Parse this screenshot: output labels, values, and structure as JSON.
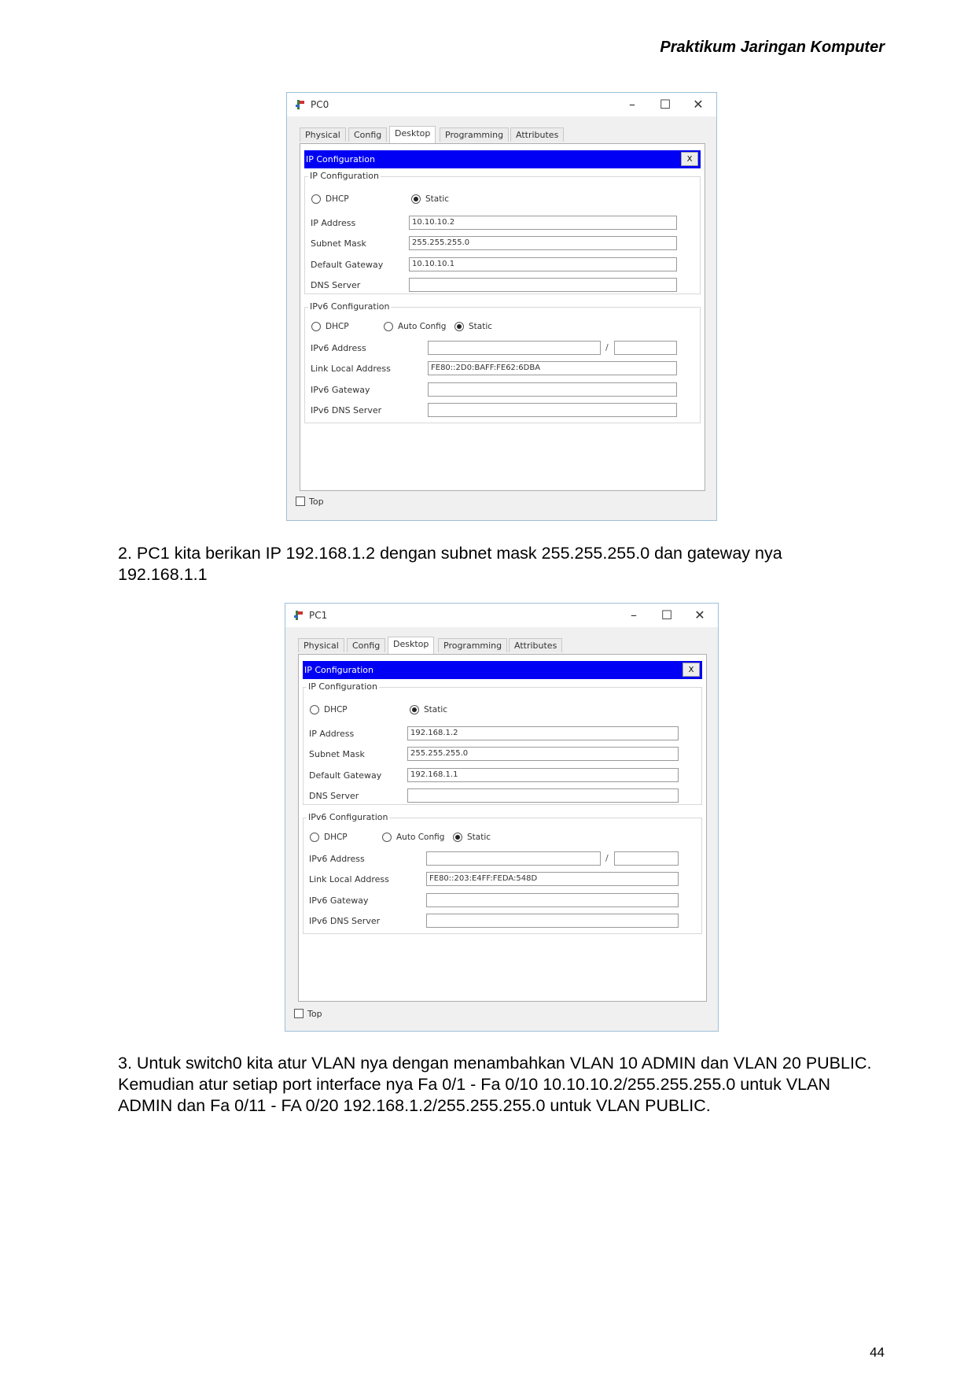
{
  "header": "Praktikum Jaringan Komputer",
  "page_number": "44",
  "step2_text": "2. PC1 kita berikan IP 192.168.1.2 dengan subnet mask 255.255.255.0 dan gateway nya 192.168.1.1",
  "step3_text": "3. Untuk switch0 kita atur VLAN nya dengan menambahkan VLAN 10 ADMIN dan VLAN 20 PUBLIC. Kemudian atur setiap port interface nya Fa 0/1 - Fa 0/10 10.10.10.2/255.255.255.0 untuk VLAN ADMIN dan Fa 0/11 - FA 0/20 192.168.1.2/255.255.255.0 untuk VLAN PUBLIC.",
  "icons": {
    "app": "packet-tracer-pc-icon",
    "minimize": "minimize-icon",
    "maximize": "maximize-icon",
    "close": "close-icon"
  },
  "windows": [
    {
      "title": "PC0",
      "controls": {
        "minimize": "–",
        "maximize": "☐",
        "close": "✕"
      },
      "tabs": [
        "Physical",
        "Config",
        "Desktop",
        "Programming",
        "Attributes"
      ],
      "active_tab": "Desktop",
      "ip_config_bar": "IP Configuration",
      "close_x": "X",
      "ipv4": {
        "group_title": "IP Configuration",
        "dhcp_label": "DHCP",
        "static_label": "Static",
        "mode": "Static",
        "ip_label": "IP Address",
        "ip_value": "10.10.10.2",
        "mask_label": "Subnet Mask",
        "mask_value": "255.255.255.0",
        "gateway_label": "Default Gateway",
        "gateway_value": "10.10.10.1",
        "dns_label": "DNS Server",
        "dns_value": ""
      },
      "ipv6": {
        "group_title": "IPv6 Configuration",
        "dhcp_label": "DHCP",
        "auto_label": "Auto Config",
        "static_label": "Static",
        "mode": "Static",
        "addr_label": "IPv6 Address",
        "addr_value": "",
        "prefix_sep": "/",
        "prefix_value": "",
        "link_local_label": "Link Local Address",
        "link_local_value": "FE80::2D0:BAFF:FE62:6DBA",
        "gateway_label": "IPv6 Gateway",
        "gateway_value": "",
        "dns_label": "IPv6 DNS Server",
        "dns_value": ""
      },
      "top_checkbox_label": "Top"
    },
    {
      "title": "PC1",
      "controls": {
        "minimize": "–",
        "maximize": "☐",
        "close": "✕"
      },
      "tabs": [
        "Physical",
        "Config",
        "Desktop",
        "Programming",
        "Attributes"
      ],
      "active_tab": "Desktop",
      "ip_config_bar": "IP Configuration",
      "close_x": "X",
      "ipv4": {
        "group_title": "IP Configuration",
        "dhcp_label": "DHCP",
        "static_label": "Static",
        "mode": "Static",
        "ip_label": "IP Address",
        "ip_value": "192.168.1.2",
        "mask_label": "Subnet Mask",
        "mask_value": "255.255.255.0",
        "gateway_label": "Default Gateway",
        "gateway_value": "192.168.1.1",
        "dns_label": "DNS Server",
        "dns_value": ""
      },
      "ipv6": {
        "group_title": "IPv6 Configuration",
        "dhcp_label": "DHCP",
        "auto_label": "Auto Config",
        "static_label": "Static",
        "mode": "Static",
        "addr_label": "IPv6 Address",
        "addr_value": "",
        "prefix_sep": "/",
        "prefix_value": "",
        "link_local_label": "Link Local Address",
        "link_local_value": "FE80::203:E4FF:FEDA:548D",
        "gateway_label": "IPv6 Gateway",
        "gateway_value": "",
        "dns_label": "IPv6 DNS Server",
        "dns_value": ""
      },
      "top_checkbox_label": "Top"
    }
  ]
}
